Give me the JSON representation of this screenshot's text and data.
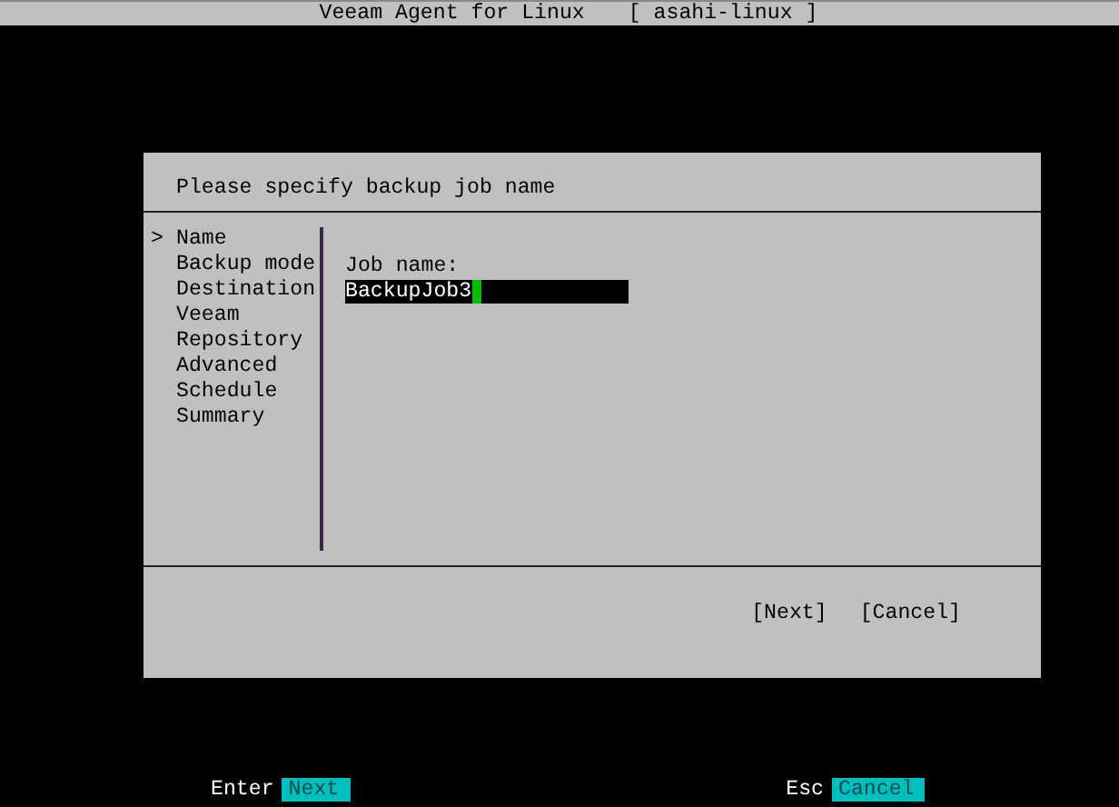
{
  "window": {
    "title": "Veeam Agent for Linux",
    "host": "[ asahi-linux ]"
  },
  "dialog": {
    "heading": "Please specify backup job name",
    "sidebar": {
      "cursor": ">",
      "items": [
        {
          "label": "Name",
          "selected": true
        },
        {
          "label": "Backup mode",
          "selected": false
        },
        {
          "label": "Destination",
          "selected": false
        },
        {
          "label": "Veeam",
          "selected": false
        },
        {
          "label": "Repository",
          "selected": false
        },
        {
          "label": "Advanced",
          "selected": false
        },
        {
          "label": "Schedule",
          "selected": false
        },
        {
          "label": "Summary",
          "selected": false
        }
      ]
    },
    "field": {
      "label": "Job name:",
      "value": "BackupJob3"
    },
    "buttons": [
      "[Next]",
      "[Cancel]"
    ]
  },
  "footer": [
    {
      "key": "Enter",
      "action": "Next"
    },
    {
      "key": "Esc",
      "action": "Cancel"
    }
  ]
}
